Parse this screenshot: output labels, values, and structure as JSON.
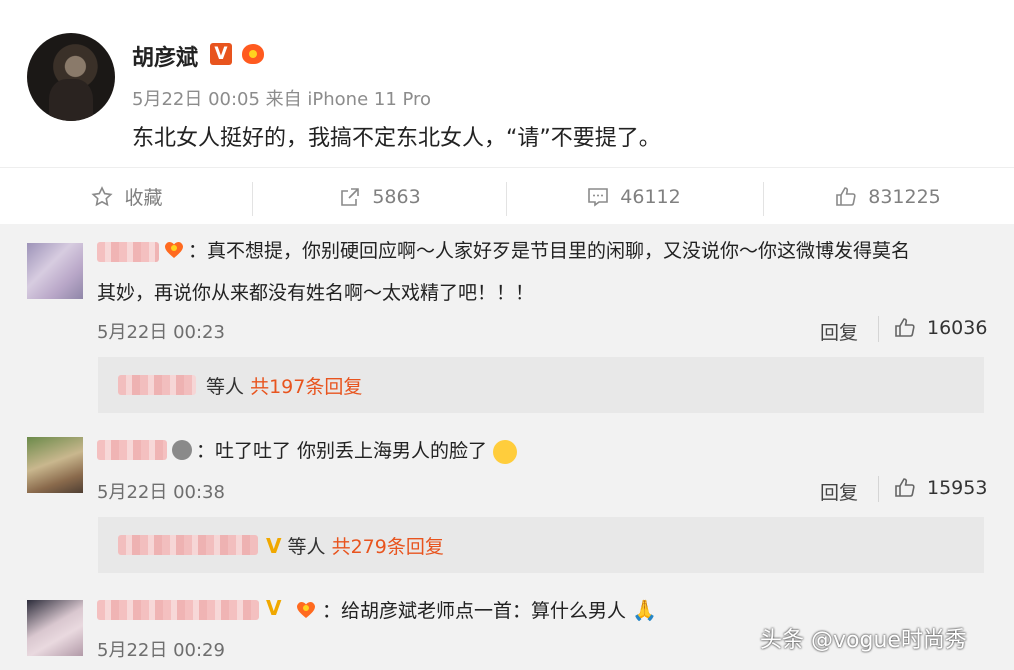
{
  "post": {
    "username": "胡彦斌",
    "verified_badge": "V",
    "meta": "5月22日 00:05 来自 iPhone 11 Pro",
    "content": "东北女人挺好的，我搞不定东北女人，“请”不要提了。"
  },
  "actions": {
    "favorite": {
      "icon": "star-outline-icon",
      "label": "收藏"
    },
    "repost": {
      "icon": "share-icon",
      "count": "5863"
    },
    "comment": {
      "icon": "comment-icon",
      "count": "46112"
    },
    "like": {
      "icon": "thumb-up-icon",
      "count": "831225"
    }
  },
  "comments": [
    {
      "text_line1": "：真不想提，你别硬回应啊～人家好歹是节目里的闲聊，又没说你～你这微博发得莫名",
      "text_line2": "其妙，再说你从来都没有姓名啊～太戏精了吧！！！",
      "time": "5月22日 00:23",
      "reply_label": "回复",
      "likes": "16036",
      "sub_replies": {
        "suffix": "等人",
        "count": "共197条回复"
      }
    },
    {
      "text_line1": "：吐了吐了 你别丢上海男人的脸了",
      "time": "5月22日 00:38",
      "reply_label": "回复",
      "likes": "15953",
      "sub_replies": {
        "badge": "V",
        "suffix": "等人",
        "count": "共279条回复"
      }
    },
    {
      "badge": "V",
      "text_line1": "：给胡彦斌老师点一首：算什么男人",
      "time": "5月22日 00:29"
    }
  ],
  "watermark": "头条 @vogue时尚秀",
  "colors": {
    "accent": "#e8541e",
    "gold": "#f0a800",
    "background": "#f2f2f2"
  }
}
